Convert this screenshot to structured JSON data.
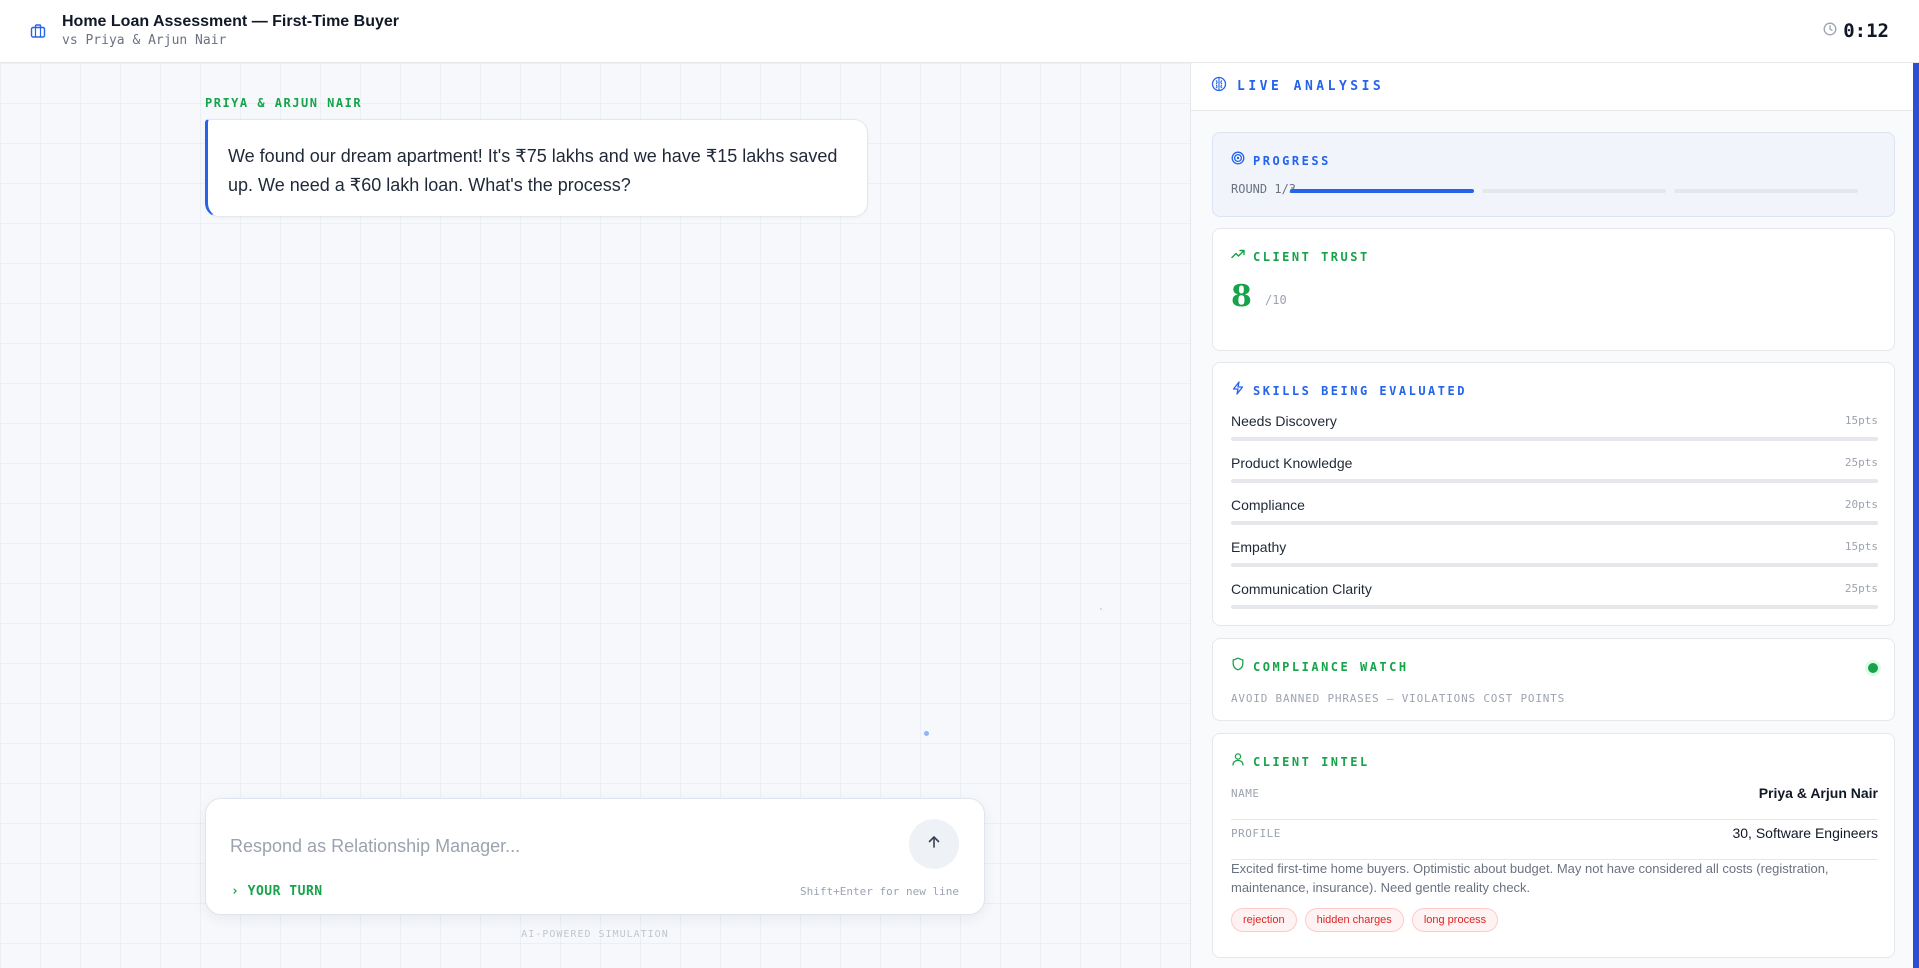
{
  "header": {
    "title": "Home Loan Assessment — First-Time Buyer",
    "subtitle": "vs Priya & Arjun Nair",
    "timer": "0:12",
    "icon": "briefcase-icon"
  },
  "chat": {
    "sender": "PRIYA & ARJUN NAIR",
    "message": "We found our dream apartment! It's ₹75 lakhs and we have ₹15 lakhs saved up. We need a ₹60 lakh loan. What's the process?",
    "input_value": "",
    "input_placeholder": "Respond as Relationship Manager...",
    "your_turn": "YOUR TURN",
    "hint": "Shift+Enter for new line",
    "footer": "AI-POWERED SIMULATION"
  },
  "panel": {
    "live_title": "LIVE ANALYSIS",
    "progress": {
      "title": "PROGRESS",
      "round_label": "ROUND 1/3",
      "current_round": 1,
      "total_rounds": 3
    },
    "trust": {
      "title": "CLIENT TRUST",
      "value": "8",
      "max": "/10"
    },
    "skills": {
      "title": "SKILLS BEING EVALUATED",
      "items": [
        {
          "name": "Needs Discovery",
          "pts": "15pts",
          "score_fraction": 0
        },
        {
          "name": "Product Knowledge",
          "pts": "25pts",
          "score_fraction": 0
        },
        {
          "name": "Compliance",
          "pts": "20pts",
          "score_fraction": 0
        },
        {
          "name": "Empathy",
          "pts": "15pts",
          "score_fraction": 0
        },
        {
          "name": "Communication Clarity",
          "pts": "25pts",
          "score_fraction": 0
        }
      ]
    },
    "compliance": {
      "title": "COMPLIANCE WATCH",
      "note": "AVOID BANNED PHRASES — VIOLATIONS COST POINTS",
      "status_color": "#16a34a"
    },
    "intel": {
      "title": "CLIENT INTEL",
      "name_label": "NAME",
      "name_value": "Priya & Arjun Nair",
      "profile_label": "PROFILE",
      "profile_value": "30, Software Engineers",
      "description": "Excited first-time home buyers. Optimistic about budget. May not have considered all costs (registration, maintenance, insurance). Need gentle reality check.",
      "tags": [
        "rejection",
        "hidden charges",
        "long process"
      ]
    }
  },
  "colors": {
    "accent_blue": "#2563eb",
    "accent_green": "#16a34a",
    "danger": "#dc2626"
  }
}
